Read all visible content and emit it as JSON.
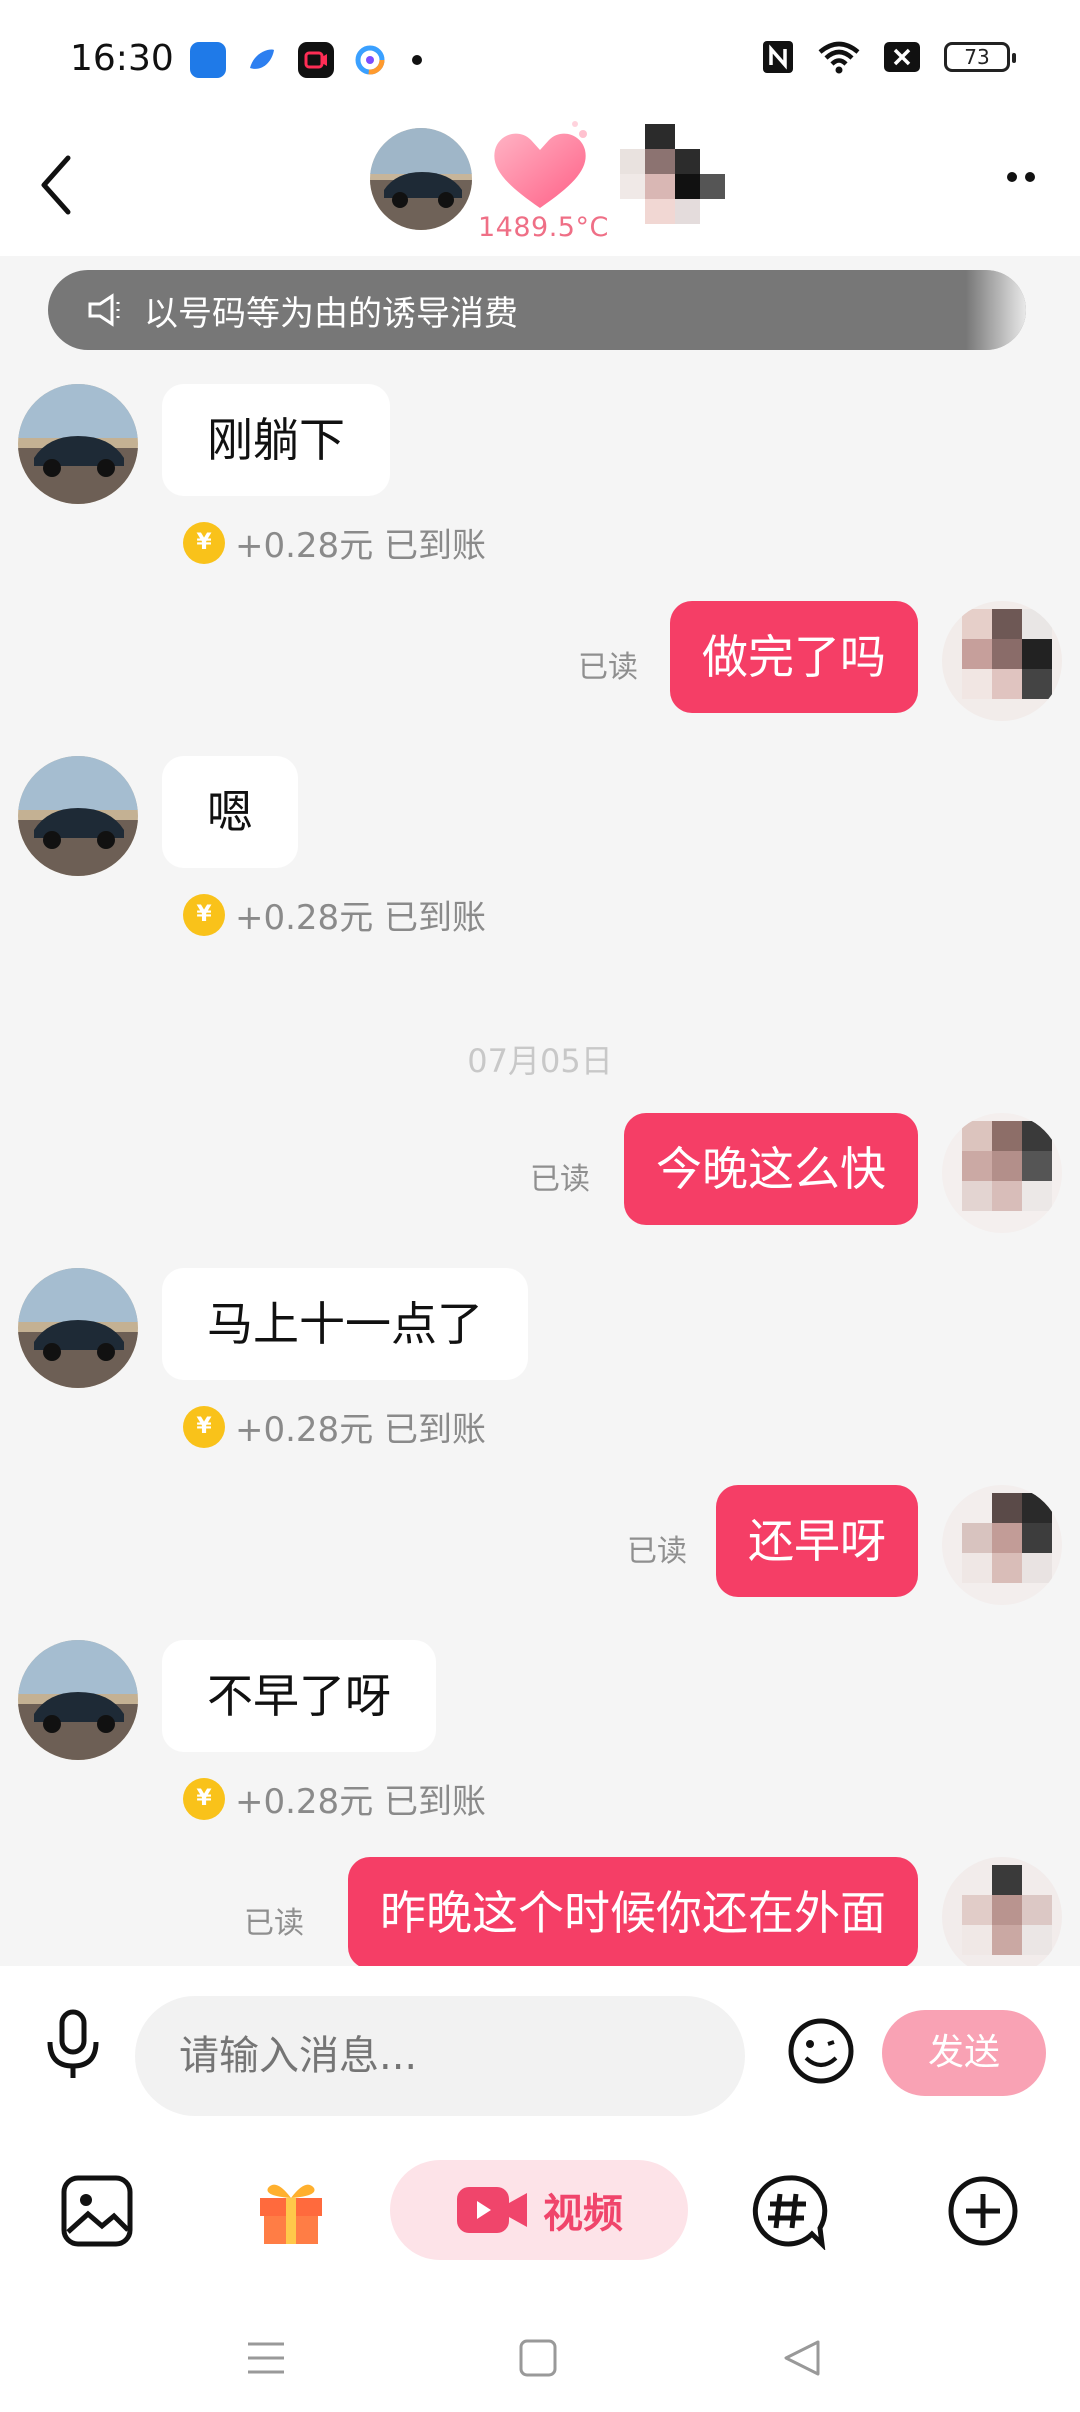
{
  "status_bar": {
    "time": "16:30",
    "app_icons": [
      "car-home-app-icon",
      "blue-bird-app-icon",
      "red-camera-app-icon",
      "colorful-circle-app-icon"
    ],
    "right_icons": [
      "nfc-icon",
      "wifi-icon",
      "signal-off-icon",
      "battery-icon"
    ],
    "battery_level": "73"
  },
  "header": {
    "heat_value": "1489.5°C"
  },
  "notice": {
    "text": "以号码等为由的诱导消费"
  },
  "messages": [
    {
      "side": "in",
      "text": "刚躺下",
      "income": "+0.28元 已到账"
    },
    {
      "side": "out",
      "text": "做完了吗",
      "read": "已读"
    },
    {
      "side": "in",
      "text": "嗯",
      "income": "+0.28元 已到账"
    },
    {
      "side": "date",
      "text": "07月05日"
    },
    {
      "side": "out",
      "text": "今晚这么快",
      "read": "已读"
    },
    {
      "side": "in",
      "text": "马上十一点了",
      "income": "+0.28元 已到账"
    },
    {
      "side": "out",
      "text": "还早呀",
      "read": "已读"
    },
    {
      "side": "in",
      "text": "不早了呀",
      "income": "+0.28元 已到账"
    },
    {
      "side": "out",
      "text": "昨晚这个时候你还在外面",
      "read": "已读"
    }
  ],
  "input": {
    "placeholder": "请输入消息...",
    "send_label": "发送"
  },
  "toolbar": {
    "video_label": "视频"
  },
  "colors": {
    "accent": "#f53e66",
    "send_disabled": "#f9a2b4",
    "coin": "#f9c21a"
  }
}
